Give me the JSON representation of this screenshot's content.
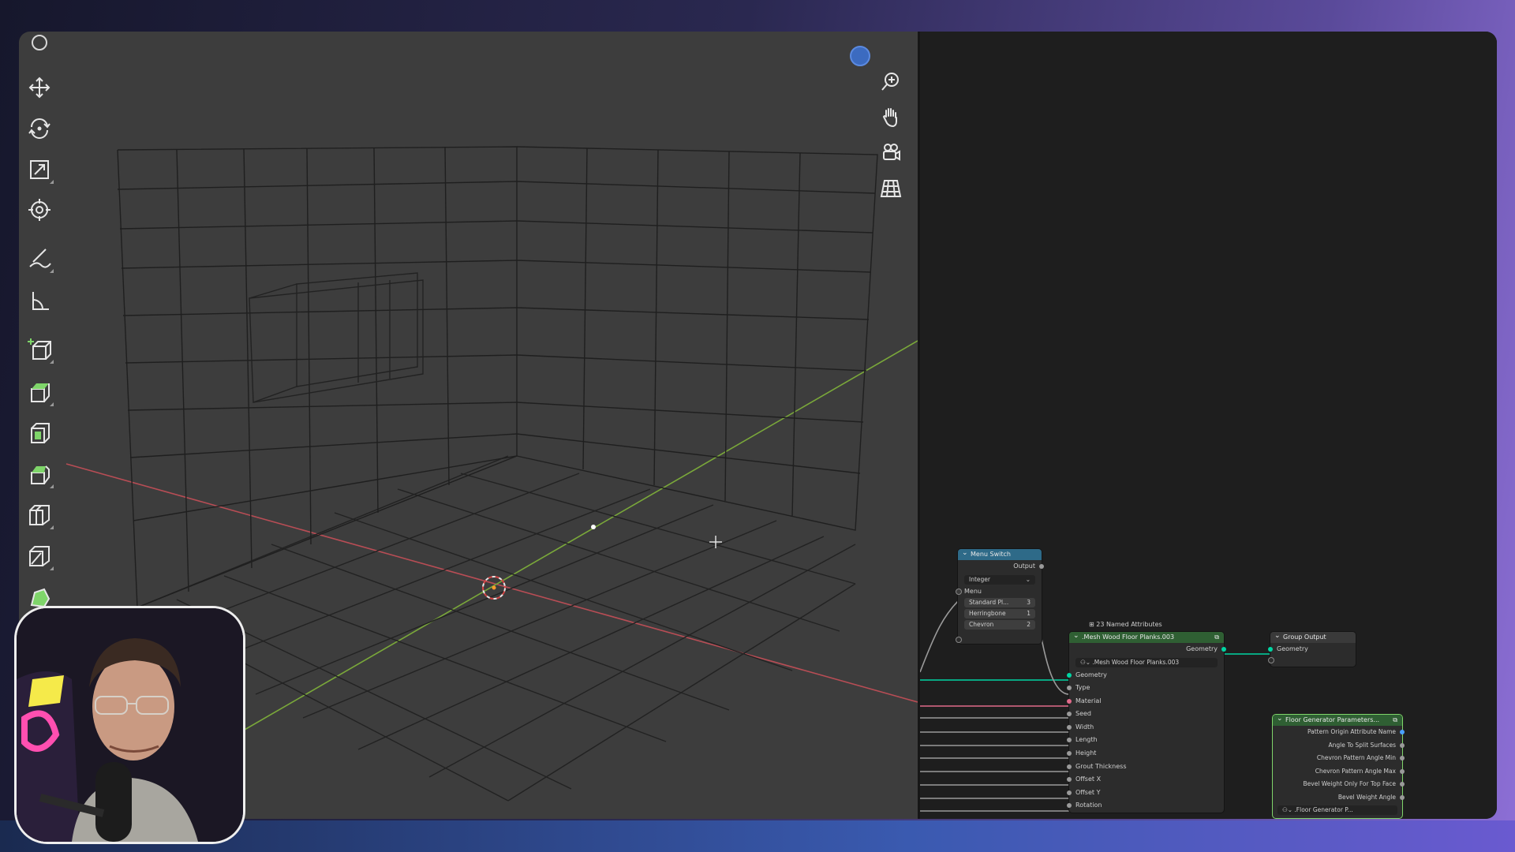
{
  "toolbar": {
    "tools": [
      {
        "name": "move",
        "icon": "move-icon"
      },
      {
        "name": "rotate",
        "icon": "rotate-icon"
      },
      {
        "name": "scale",
        "icon": "scale-icon"
      },
      {
        "name": "transform",
        "icon": "transform-icon"
      },
      {
        "name": "annotate",
        "icon": "annotate-icon"
      },
      {
        "name": "measure",
        "icon": "measure-icon"
      },
      {
        "name": "add-cube",
        "icon": "add-cube-icon"
      },
      {
        "name": "extrude",
        "icon": "extrude-icon"
      },
      {
        "name": "inset",
        "icon": "inset-icon"
      },
      {
        "name": "bevel",
        "icon": "bevel-icon"
      },
      {
        "name": "loop-cut",
        "icon": "loop-cut-icon"
      },
      {
        "name": "knife",
        "icon": "knife-icon"
      },
      {
        "name": "poly-build",
        "icon": "poly-build-icon"
      }
    ]
  },
  "navigation": {
    "buttons": [
      {
        "name": "zoom",
        "icon": "zoom-icon"
      },
      {
        "name": "pan",
        "icon": "hand-icon"
      },
      {
        "name": "camera",
        "icon": "camera-icon"
      },
      {
        "name": "perspective",
        "icon": "grid-icon"
      }
    ]
  },
  "nodes": {
    "menu_switch": {
      "title": "Menu Switch",
      "output": "Output",
      "type": "Integer",
      "menu_label": "Menu",
      "items": [
        {
          "label": "Standard Pl...",
          "value": "3"
        },
        {
          "label": "Herringbone",
          "value": "1"
        },
        {
          "label": "Chevron",
          "value": "2"
        }
      ]
    },
    "named_attributes": {
      "label": "23 Named Attributes"
    },
    "mesh_floor": {
      "title": ".Mesh Wood Floor Planks.003",
      "output": "Geometry",
      "group_value": ".Mesh Wood Floor Planks.003",
      "inputs": [
        "Geometry",
        "Type",
        "Material",
        "Seed",
        "Width",
        "Length",
        "Height",
        "Grout Thickness",
        "Offset X",
        "Offset Y",
        "Rotation"
      ]
    },
    "group_output": {
      "title": "Group Output",
      "input": "Geometry"
    },
    "floor_params": {
      "title": "Floor Generator Parameters...",
      "outputs": [
        "Pattern Origin Attribute Name",
        "Angle To Split Surfaces",
        "Chevron Pattern Angle Min",
        "Chevron Pattern Angle Max",
        "Bevel Weight Only For Top Face",
        "Bevel Weight Angle"
      ],
      "footer": ".Floor Generator P..."
    }
  },
  "colors": {
    "viewport_bg": "#3d3d3d",
    "node_editor_bg": "#1e1e1e",
    "menu_switch_header": "#2e6a88",
    "group_header": "#2f5f33",
    "geometry_socket": "#00d6a3",
    "x_axis": "#c04a52",
    "y_axis": "#7aa83a"
  }
}
